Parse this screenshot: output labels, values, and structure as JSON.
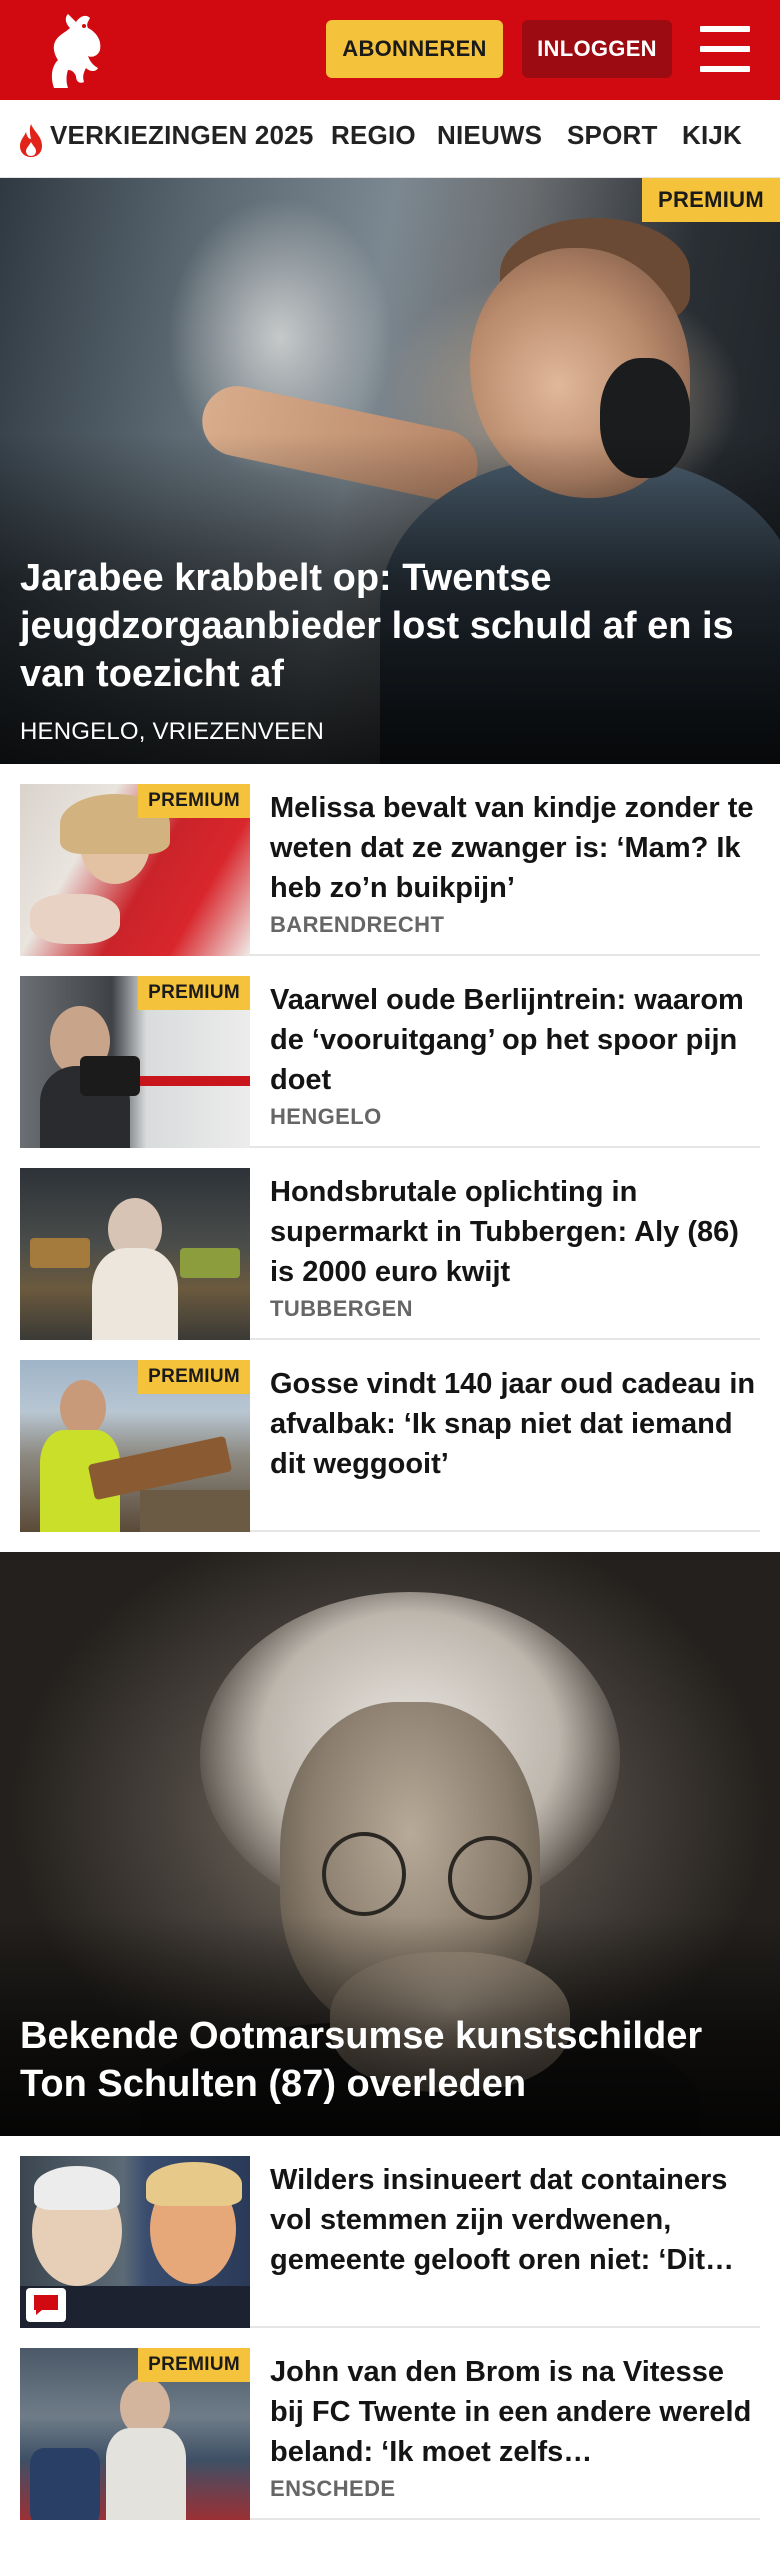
{
  "header": {
    "subscribe_label": "ABONNEREN",
    "login_label": "INLOGGEN",
    "logo_icon": "twente-horse-logo",
    "menu_icon": "hamburger-menu-icon",
    "colors": {
      "brand_red": "#d10a11",
      "login_red": "#9d0b12",
      "premium_yellow": "#f5c33b"
    }
  },
  "nav": {
    "items": [
      {
        "label": "VERKIEZINGEN 2025",
        "icon": "flame-icon"
      },
      {
        "label": "REGIO"
      },
      {
        "label": "NIEUWS"
      },
      {
        "label": "SPORT"
      },
      {
        "label": "KIJK"
      }
    ]
  },
  "hero": {
    "badge": "PREMIUM",
    "title": "Jarabee krabbelt op: Twentse jeugdzorgaanbieder lost schuld af en is van toezicht af",
    "location": "HENGELO, VRIEZENVEEN"
  },
  "articles": [
    {
      "badge": "PREMIUM",
      "title": "Melissa bevalt van kindje zonder te weten dat ze zwanger is: ‘Mam? Ik heb zo’n buikpijn’",
      "location": "BARENDRECHT"
    },
    {
      "badge": "PREMIUM",
      "title": "Vaarwel oude Berlijntrein: waarom de ‘vooruitgang’ op het spoor pijn doet",
      "location": "HENGELO"
    },
    {
      "badge": "",
      "title": "Hondsbrutale oplichting in supermarkt in Tubbergen: Aly (86) is 2000 euro kwijt",
      "location": "TUBBERGEN"
    },
    {
      "badge": "PREMIUM",
      "title": "Gosse vindt 140 jaar oud cadeau in afvalbak: ‘Ik snap niet dat iemand dit weggooit’",
      "location": ""
    }
  ],
  "hero2": {
    "title": "Bekende Ootmarsumse kunstschilder Ton Schulten (87) overleden"
  },
  "articles2": [
    {
      "badge": "",
      "title": "Wilders insinueert dat containers vol stemmen zijn verdwenen, gemeente gelooft oren niet: ‘Dit…",
      "location": "",
      "icon": "comment-icon"
    },
    {
      "badge": "PREMIUM",
      "title": "John van den Brom is na Vitesse bij FC Twente in een andere wereld beland: ‘Ik moet zelfs…",
      "location": "ENSCHEDE"
    }
  ]
}
